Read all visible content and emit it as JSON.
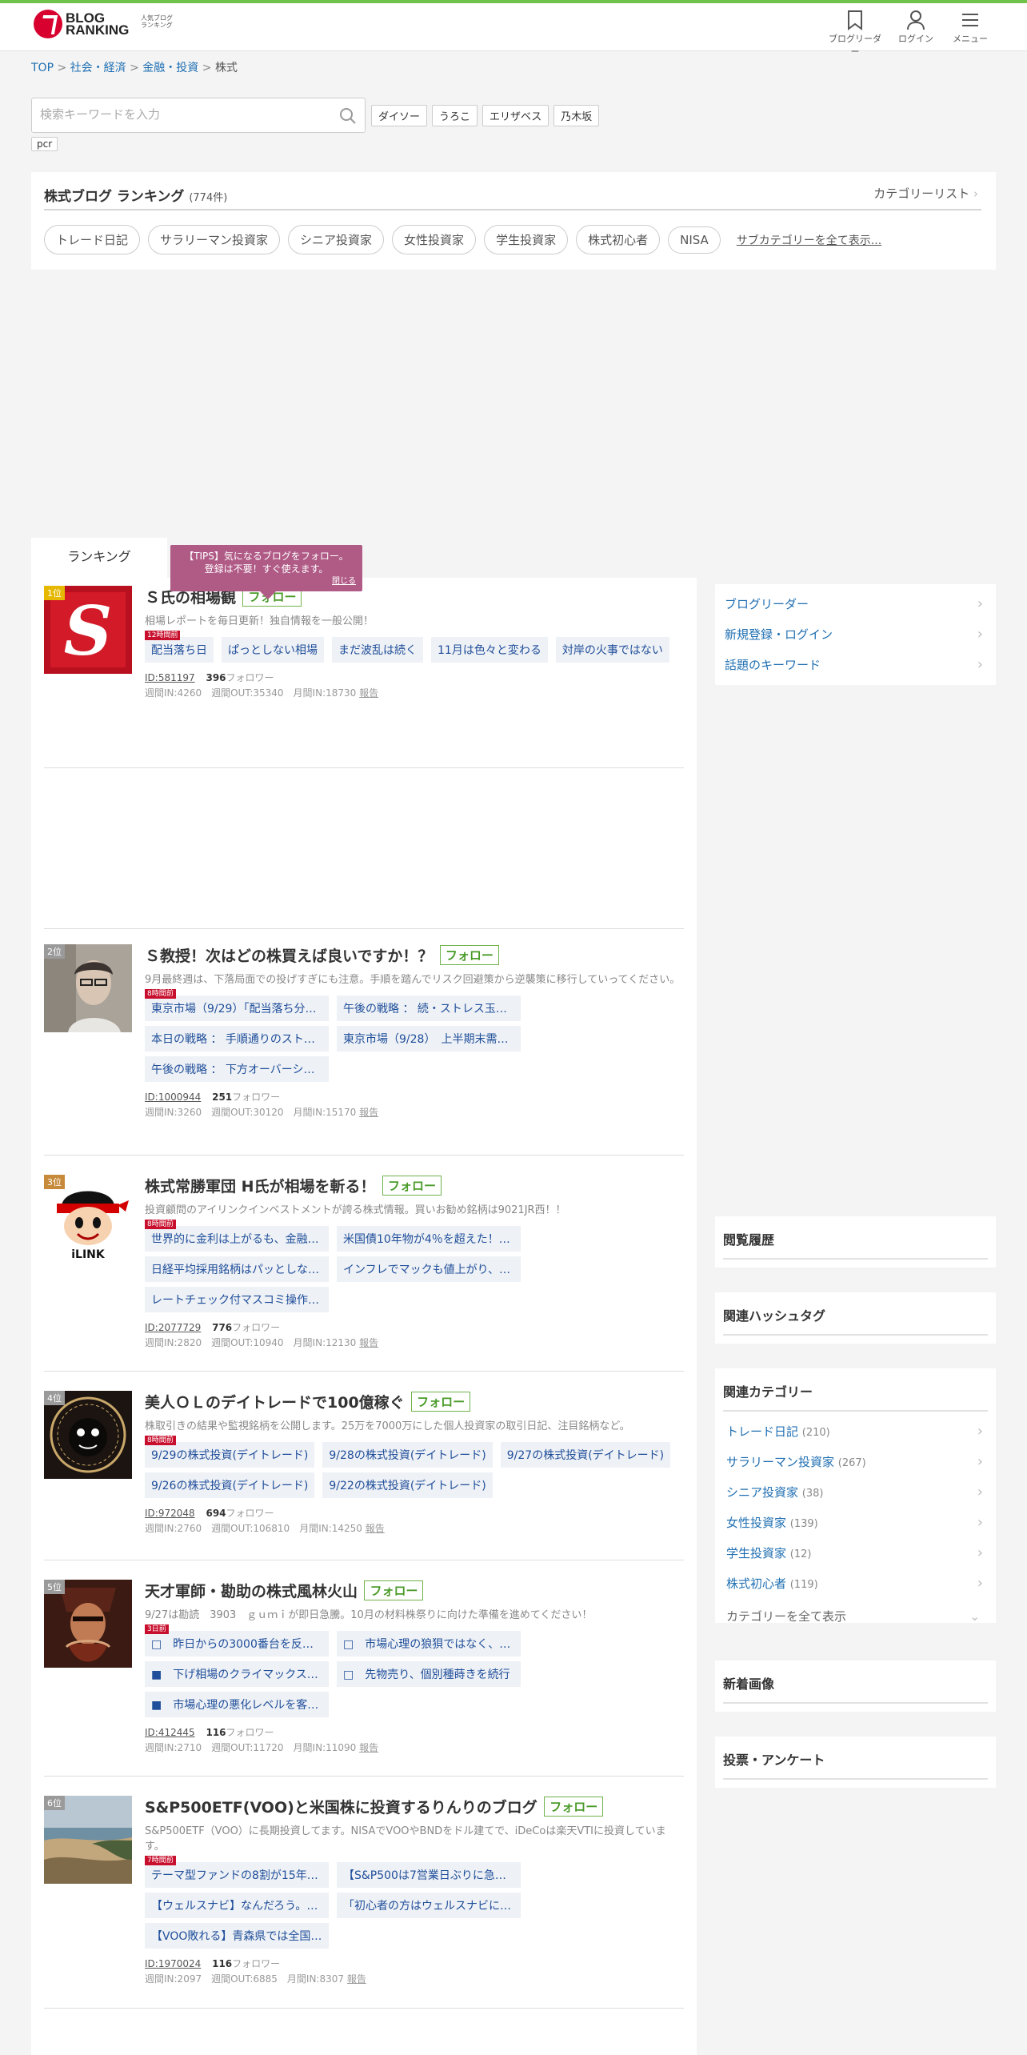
{
  "header": {
    "logo_line1": "BLOG",
    "logo_line2": "RANKING",
    "logo_sub": "人気ブログランキング",
    "icons": [
      {
        "name": "bookmark-icon",
        "label": "ブログリーダー"
      },
      {
        "name": "user-icon",
        "label": "ログイン"
      },
      {
        "name": "menu-icon",
        "label": "メニュー"
      }
    ]
  },
  "breadcrumb": {
    "items": [
      "TOP",
      "社会・経済",
      "金融・投資"
    ],
    "current": "株式",
    "sep": ">"
  },
  "search": {
    "placeholder": "検索キーワードを入力",
    "keywords": [
      "ダイソー",
      "うろこ",
      "エリザベス",
      "乃木坂",
      "pcr"
    ]
  },
  "category": {
    "title": "株式ブログ ランキング",
    "count": "(774件)",
    "list_link": "カテゴリーリスト",
    "subcategories": [
      "トレード日記",
      "サラリーマン投資家",
      "シニア投資家",
      "女性投資家",
      "学生投資家",
      "株式初心者",
      "NISA"
    ],
    "show_all": "サブカテゴリーを全て表示..."
  },
  "tab": {
    "label": "ランキング"
  },
  "tips": {
    "line1": "【TIPS】気になるブログをフォロー。",
    "line2": "登録は不要！すぐ使えます。",
    "close": "閉じる"
  },
  "follow_label": "フォロー",
  "follower_label": "フォロワー",
  "report_label": "報告",
  "entries": [
    {
      "rank": "1位",
      "rank_color": "#e6b800",
      "title": "Ｓ氏の相場観",
      "desc": "相場レポートを毎日更新！独自情報を一般公開！",
      "hours": "12時間前",
      "posts": [
        "配当落ち日",
        "ぱっとしない相場",
        "まだ波乱は続く",
        "11月は色々と変わる",
        "対岸の火事ではない"
      ],
      "id": "ID:581197",
      "followers": "396",
      "stats": "週間IN:4260　週間OUT:35340　月間IN:18730"
    },
    {
      "rank": "2位",
      "rank_color": "#9a9a9a",
      "title": "Ｓ教授！次はどの株買えば良いですか！？",
      "desc": "9月最終週は、下落局面での投げすぎにも注意。手順を踏んでリスク回避策から逆襲策に移行していってください。",
      "hours": "8時間前",
      "posts": [
        "東京市場（9/29）「配当落ち分を…",
        "午後の戦略 ： 続・ストレス玉…",
        "本日の戦略 ： 手順通りのスト…",
        "東京市場（9/28）　上半期末需…",
        "午後の戦略 ： 下方オーバーシ…"
      ],
      "id": "ID:1000944",
      "followers": "251",
      "stats": "週間IN:3260　週間OUT:30120　月間IN:15170"
    },
    {
      "rank": "3位",
      "rank_color": "#c68a3a",
      "title": "株式常勝軍団 H氏が相場を斬る！",
      "desc": "投資顧問のアイリンクインベストメントが誇る株式情報。買いお勧め銘柄は9021JR西！！",
      "hours": "8時間前",
      "posts": [
        "世界的に金利は上がるも、金融…",
        "米国債10年物が4％を超えた！…",
        "日経平均採用銘柄はパッとしな…",
        "インフレでマックも値上がり、…",
        "レートチェック付マスコミ操作…"
      ],
      "id": "ID:2077729",
      "followers": "776",
      "stats": "週間IN:2820　週間OUT:10940　月間IN:12130"
    },
    {
      "rank": "4位",
      "rank_color": "#9a9a9a",
      "title": "美人ＯＬのデイトレードで100億稼ぐ",
      "desc": "株取引きの結果や監視銘柄を公開します。25万を7000万にした個人投資家の取引日記、注目銘柄など。",
      "hours": "8時間前",
      "posts": [
        "9/29の株式投資(デイトレード)",
        "9/28の株式投資(デイトレード)",
        "9/27の株式投資(デイトレード)",
        "9/26の株式投資(デイトレード)",
        "9/22の株式投資(デイトレード)"
      ],
      "id": "ID:972048",
      "followers": "694",
      "stats": "週間IN:2760　週間OUT:106810　月間IN:14250"
    },
    {
      "rank": "5位",
      "rank_color": "#9a9a9a",
      "title": "天才軍師・勘助の株式風林火山",
      "desc": "9/27は勘読　3903　ｇｕｍｉが即日急騰。10月の材料株祭りに向けた準備を進めてください！",
      "hours": "3日前",
      "posts": [
        "□　昨日からの3000番台を反撃…",
        "□　市場心理の狼狽ではなく、…",
        "■　下げ相場のクライマックス…",
        "□　先物売り、個別種蒔きを続行",
        "■　市場心理の悪化レベルを客…"
      ],
      "id": "ID:412445",
      "followers": "116",
      "stats": "週間IN:2710　週間OUT:11720　月間IN:11090"
    },
    {
      "rank": "6位",
      "rank_color": "#9a9a9a",
      "title": "S&P500ETF(VOO)と米国株に投資するりんりのブログ",
      "desc": "S&P500ETF（VOO）に長期投資してます。NISAでVOOやBNDをドル建てで、iDeCoは楽天VTIに投資しています。",
      "hours": "7時間前",
      "posts": [
        "テーマ型ファンドの8割が15年…",
        "【S&P500は7営業日ぶりに急反…",
        "【ウェルスナビ】なんだろう。…",
        "「初心者の方はウェルスナビに…",
        "【VOO敗れる】青森県では全国…"
      ],
      "id": "ID:1970024",
      "followers": "116",
      "stats": "週間IN:2097　週間OUT:6885　月間IN:8307"
    }
  ],
  "sidebar": {
    "links": [
      "ブログリーダー",
      "新規登録・ログイン",
      "話題のキーワード"
    ],
    "history_title": "閲覧履歴",
    "hashtag_title": "関連ハッシュタグ",
    "related_title": "関連カテゴリー",
    "related": [
      {
        "name": "トレード日記",
        "count": "(210)"
      },
      {
        "name": "サラリーマン投資家",
        "count": "(267)"
      },
      {
        "name": "シニア投資家",
        "count": "(38)"
      },
      {
        "name": "女性投資家",
        "count": "(139)"
      },
      {
        "name": "学生投資家",
        "count": "(12)"
      },
      {
        "name": "株式初心者",
        "count": "(119)"
      }
    ],
    "show_all_cats": "カテゴリーを全て表示",
    "new_images_title": "新着画像",
    "vote_title": "投票・アンケート"
  }
}
